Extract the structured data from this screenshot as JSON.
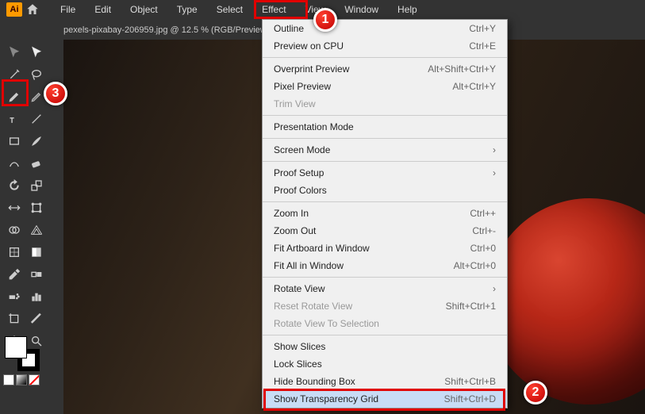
{
  "app": {
    "logo": "Ai"
  },
  "menubar": [
    "File",
    "Edit",
    "Object",
    "Type",
    "Select",
    "Effect",
    "View",
    "Window",
    "Help"
  ],
  "document_tab": "pexels-pixabay-206959.jpg @ 12.5 % (RGB/Preview)",
  "view_menu": [
    {
      "label": "Outline",
      "shortcut": "Ctrl+Y"
    },
    {
      "label": "Preview on CPU",
      "shortcut": "Ctrl+E"
    },
    {
      "sep": true
    },
    {
      "label": "Overprint Preview",
      "shortcut": "Alt+Shift+Ctrl+Y"
    },
    {
      "label": "Pixel Preview",
      "shortcut": "Alt+Ctrl+Y"
    },
    {
      "label": "Trim View",
      "shortcut": "",
      "disabled": true
    },
    {
      "sep": true
    },
    {
      "label": "Presentation Mode",
      "shortcut": ""
    },
    {
      "sep": true
    },
    {
      "label": "Screen Mode",
      "shortcut": "",
      "submenu": true
    },
    {
      "sep": true
    },
    {
      "label": "Proof Setup",
      "shortcut": "",
      "submenu": true
    },
    {
      "label": "Proof Colors",
      "shortcut": ""
    },
    {
      "sep": true
    },
    {
      "label": "Zoom In",
      "shortcut": "Ctrl++"
    },
    {
      "label": "Zoom Out",
      "shortcut": "Ctrl+-"
    },
    {
      "label": "Fit Artboard in Window",
      "shortcut": "Ctrl+0"
    },
    {
      "label": "Fit All in Window",
      "shortcut": "Alt+Ctrl+0"
    },
    {
      "sep": true
    },
    {
      "label": "Rotate View",
      "shortcut": "",
      "submenu": true
    },
    {
      "label": "Reset Rotate View",
      "shortcut": "Shift+Ctrl+1",
      "disabled": true
    },
    {
      "label": "Rotate View To Selection",
      "shortcut": "",
      "disabled": true
    },
    {
      "sep": true
    },
    {
      "label": "Show Slices",
      "shortcut": ""
    },
    {
      "label": "Lock Slices",
      "shortcut": ""
    },
    {
      "label": "Hide Bounding Box",
      "shortcut": "Shift+Ctrl+B"
    },
    {
      "label": "Show Transparency Grid",
      "shortcut": "Shift+Ctrl+D",
      "highlighted": true
    }
  ],
  "callouts": {
    "1": "1",
    "2": "2",
    "3": "3"
  }
}
